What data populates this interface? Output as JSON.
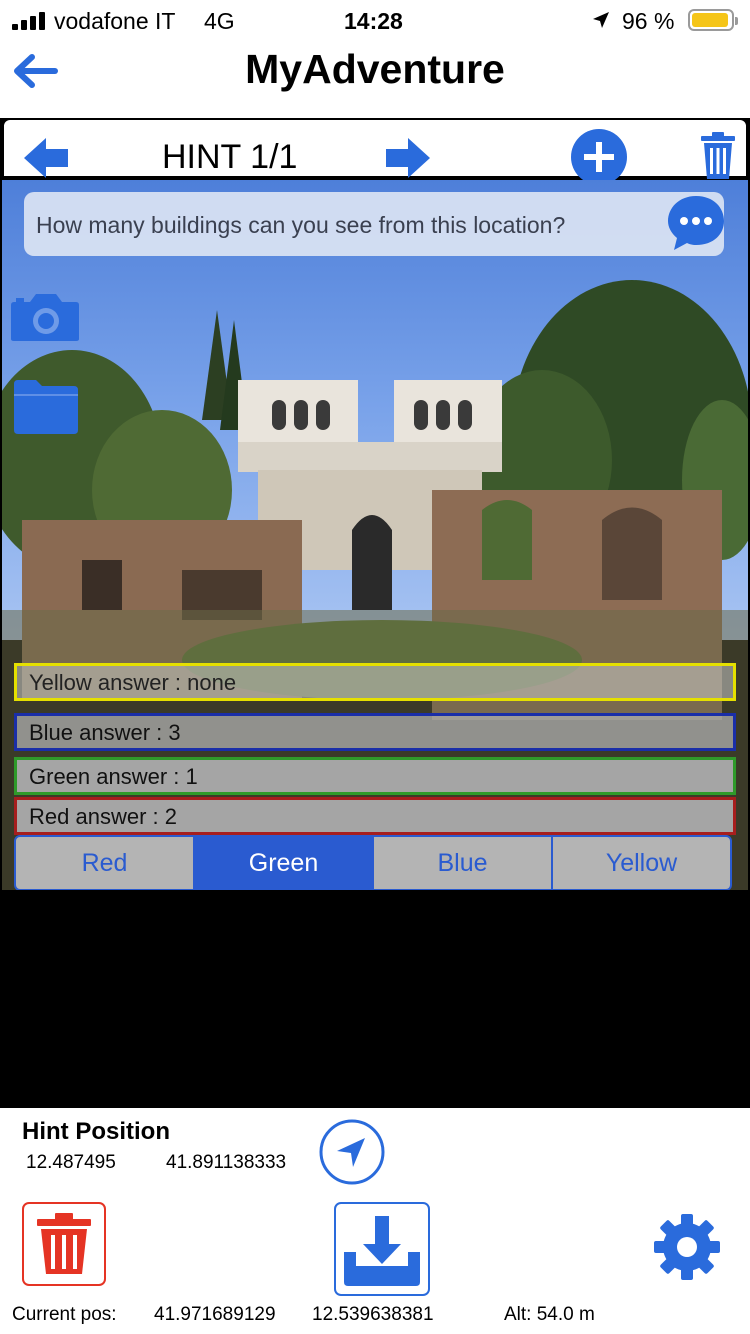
{
  "status_bar": {
    "carrier": "vodafone IT",
    "network": "4G",
    "time": "14:28",
    "battery": "96 %",
    "battery_color": "#f5c518"
  },
  "nav": {
    "title": "MyAdventure",
    "back_icon": "back-arrow-icon"
  },
  "hint_bar": {
    "title": "HINT 1/1",
    "icons": [
      "prev-arrow-icon",
      "next-arrow-icon",
      "add-circle-icon",
      "trash-icon"
    ]
  },
  "question": {
    "text": "How many buildings can you see from this location?",
    "icon": "chat-bubble-icon"
  },
  "side_icons": [
    "camera-icon",
    "folder-icon"
  ],
  "answers": {
    "yellow": "Yellow answer : none",
    "blue": "Blue answer : 3",
    "green": "Green answer : 1",
    "red": "Red answer : 2"
  },
  "segments": {
    "options": [
      "Red",
      "Green",
      "Blue",
      "Yellow"
    ],
    "selected": "Green"
  },
  "hint_position": {
    "title": "Hint Position",
    "longitude": "12.487495",
    "latitude": "41.891138333",
    "icon": "location-arrow-icon"
  },
  "footer": {
    "current_label": "Current pos:",
    "current_lat": "41.971689129",
    "current_lon": "12.539638381",
    "altitude": "Alt: 54.0 m",
    "icons": [
      "delete-icon",
      "download-icon",
      "gear-icon"
    ]
  },
  "colors": {
    "accent": "#2a5bd0",
    "danger": "#e53424",
    "yellow": "#e5e000",
    "blue": "#1a2ea8",
    "green": "#2f9a2a",
    "red": "#a61e1e"
  }
}
